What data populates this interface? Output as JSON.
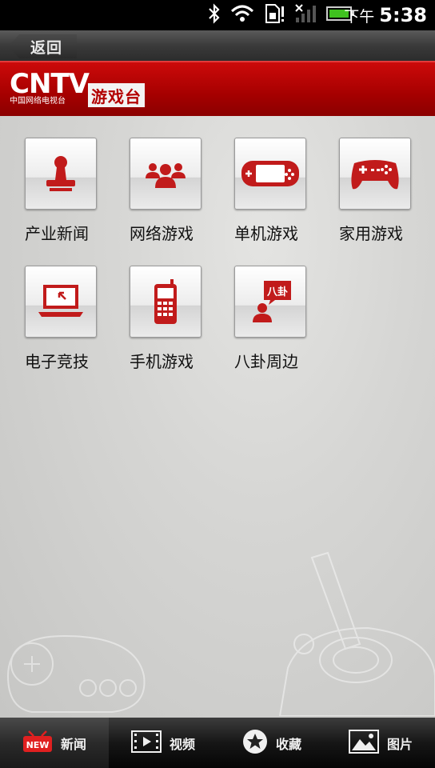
{
  "status_bar": {
    "ampm": "下午",
    "time": "5:38"
  },
  "header": {
    "back_label": "返回",
    "logo_main": "CNTV",
    "logo_sub": "中国网络电视台",
    "channel_badge": "游戏台"
  },
  "categories": [
    {
      "label": "产业新闻",
      "icon": "stamp-icon"
    },
    {
      "label": "网络游戏",
      "icon": "people-group-icon"
    },
    {
      "label": "单机游戏",
      "icon": "handheld-console-icon"
    },
    {
      "label": "家用游戏",
      "icon": "gamepad-icon"
    },
    {
      "label": "电子竞技",
      "icon": "laptop-icon"
    },
    {
      "label": "手机游戏",
      "icon": "mobile-phone-icon"
    },
    {
      "label": "八卦周边",
      "icon": "gossip-speech-icon",
      "bubble_text": "八卦"
    }
  ],
  "bottom_nav": [
    {
      "label": "新闻",
      "icon": "new-badge-icon",
      "badge": "NEW",
      "active": true
    },
    {
      "label": "视频",
      "icon": "film-play-icon",
      "active": false
    },
    {
      "label": "收藏",
      "icon": "star-circle-icon",
      "active": false
    },
    {
      "label": "图片",
      "icon": "picture-icon",
      "active": false
    }
  ],
  "colors": {
    "brand_red": "#b30000",
    "icon_red": "#c11b1b"
  }
}
